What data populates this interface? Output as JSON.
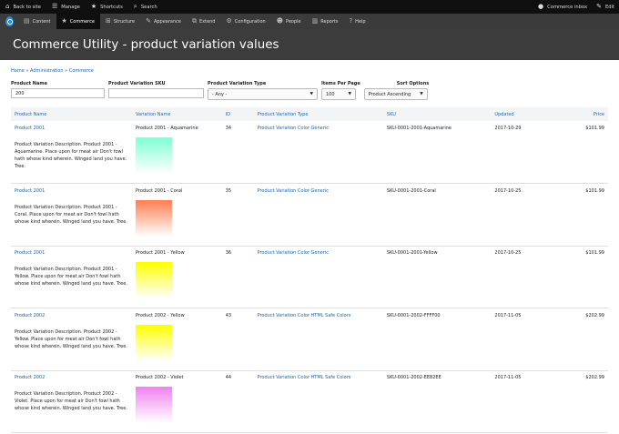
{
  "toolbar": {
    "back": "Back to site",
    "manage": "Manage",
    "shortcuts": "Shortcuts",
    "search": "Search",
    "inbox": "Commerce inbox",
    "edit": "Edit"
  },
  "admin_menu": [
    "Content",
    "Commerce",
    "Structure",
    "Appearance",
    "Extend",
    "Configuration",
    "People",
    "Reports",
    "Help"
  ],
  "page_title": "Commerce Utility - product variation values",
  "breadcrumb": "Home » Administration » Commerce",
  "filters": {
    "product_name_label": "Product Name",
    "product_name_value": "200",
    "sku_label": "Product Variation SKU",
    "sku_value": "",
    "type_label": "Product Variation Type",
    "type_value": "- Any -",
    "per_page_label": "Items Per Page",
    "per_page_value": "100",
    "sort_label": "Sort Options",
    "sort_value": "Product Ascending"
  },
  "columns": [
    "Product Name",
    "Variation Name",
    "ID",
    "Product Variation Type",
    "SKU",
    "Updated",
    "Price"
  ],
  "rows": [
    {
      "product": "Product 2001",
      "variation": "Product 2001 - Aquamarine",
      "id": "34",
      "type": "Product Variation Color Generic",
      "sku": "SKU-0001-2001-Aquamarine",
      "updated": "2017-10-29",
      "price": "$101.99",
      "description": "Product Variation Description. Product 2001 - Aquamarine. Place upon for meat air Don't fowl hath whose kind wherein. Winged land you have. Tree.",
      "color": "#7fffd4"
    },
    {
      "product": "Product 2001",
      "variation": "Product 2001 - Coral",
      "id": "35",
      "type": "Product Variation Color Generic",
      "sku": "SKU-0001-2001-Coral",
      "updated": "2017-10-25",
      "price": "$101.99",
      "description": "Product Variation Description. Product 2001 - Coral. Place upon for meat air Don't fowl hath whose kind wherein. Winged land you have. Tree.",
      "color": "#ff7f50"
    },
    {
      "product": "Product 2001",
      "variation": "Product 2001 - Yellow",
      "id": "36",
      "type": "Product Variation Color Generic",
      "sku": "SKU-0001-2001-Yellow",
      "updated": "2017-10-25",
      "price": "$101.99",
      "description": "Product Variation Description. Product 2001 - Yellow. Place upon for meat air Don't fowl hath whose kind wherein. Winged land you have. Tree.",
      "color": "#ffff00"
    },
    {
      "product": "Product 2002",
      "variation": "Product 2002 - Yellow",
      "id": "43",
      "type": "Product Variation Color HTML Safe Colors",
      "sku": "SKU-0001-2002-FFFF00",
      "updated": "2017-11-05",
      "price": "$202.99",
      "description": "Product Variation Description. Product 2002 - Yellow. Place upon for meat air Don't fowl hath whose kind wherein. Winged land you have. Tree.",
      "color": "#ffff00"
    },
    {
      "product": "Product 2002",
      "variation": "Product 2002 - Violet",
      "id": "44",
      "type": "Product Variation Color HTML Safe Colors",
      "sku": "SKU-0001-2002-EE82EE",
      "updated": "2017-11-05",
      "price": "$202.99",
      "description": "Product Variation Description. Product 2002 - Violet. Place upon for meat air Don't fowl hath whose kind wherein. Winged land you have. Tree.",
      "color": "#ee82ee"
    }
  ]
}
